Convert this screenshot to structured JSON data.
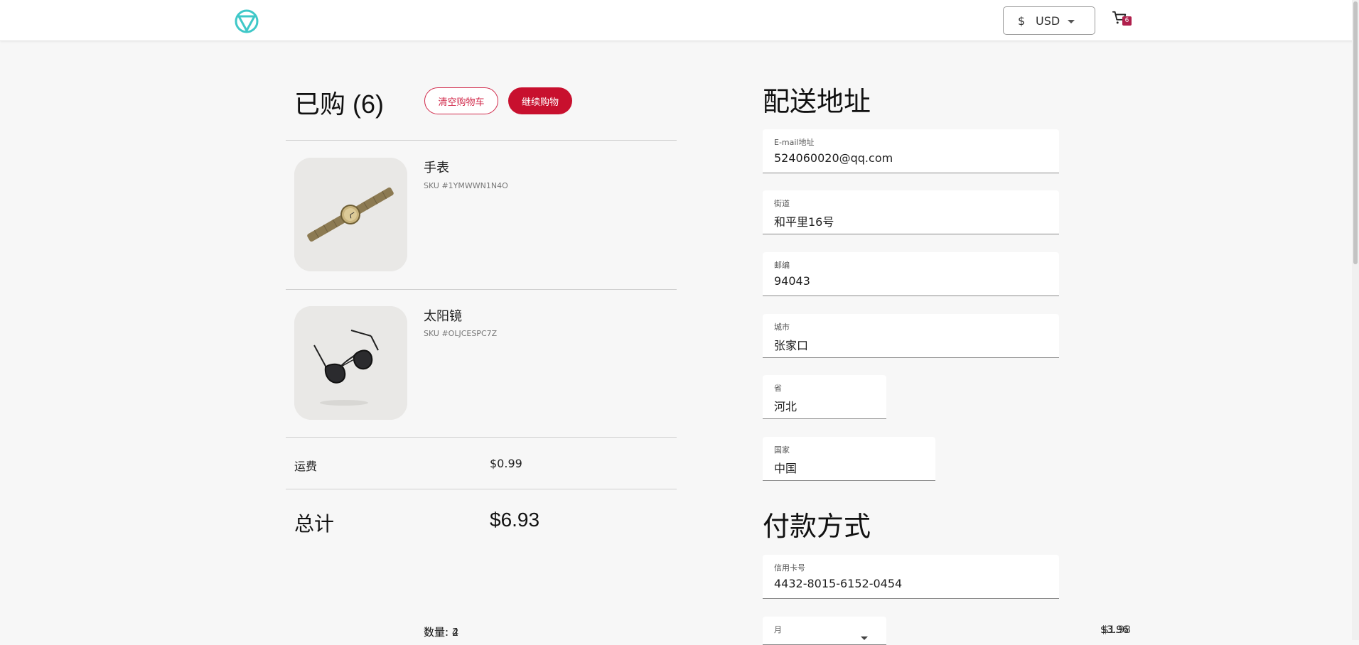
{
  "header": {
    "currency_symbol": "$",
    "currency_code": "USD",
    "cart_count": "6"
  },
  "cart": {
    "title": "已购 (6)",
    "empty_label": "清空购物车",
    "continue_label": "继续购物",
    "items": [
      {
        "name": "手表",
        "sku": "SKU #1YMWWN1N4O",
        "image": "watch"
      },
      {
        "name": "太阳镜",
        "sku": "SKU #OLJCESPC7Z",
        "image": "sunglasses"
      }
    ],
    "shipping_label": "运费",
    "shipping_value": "$0.99",
    "total_label": "总计",
    "total_value": "$6.93",
    "qty_a": "数量: 2",
    "qty_b": "数量: 4",
    "price_a": "$3.96",
    "price_b": "$1.98"
  },
  "shipping_address": {
    "title": "配送地址",
    "email_label": "E-mail地址",
    "email_value": "524060020@qq.com",
    "street_label": "街道",
    "street_value": "和平里16号",
    "zip_label": "邮编",
    "zip_value": "94043",
    "city_label": "城市",
    "city_value": "张家口",
    "state_label": "省",
    "state_value": "河北",
    "country_label": "国家",
    "country_value": "中国"
  },
  "payment": {
    "title": "付款方式",
    "card_label": "信用卡号",
    "card_value": "4432-8015-6152-0454",
    "month_label": "月"
  },
  "colors": {
    "accent": "#c8102e",
    "logo": "#3fc8c8",
    "badge": "#b01f4c"
  }
}
